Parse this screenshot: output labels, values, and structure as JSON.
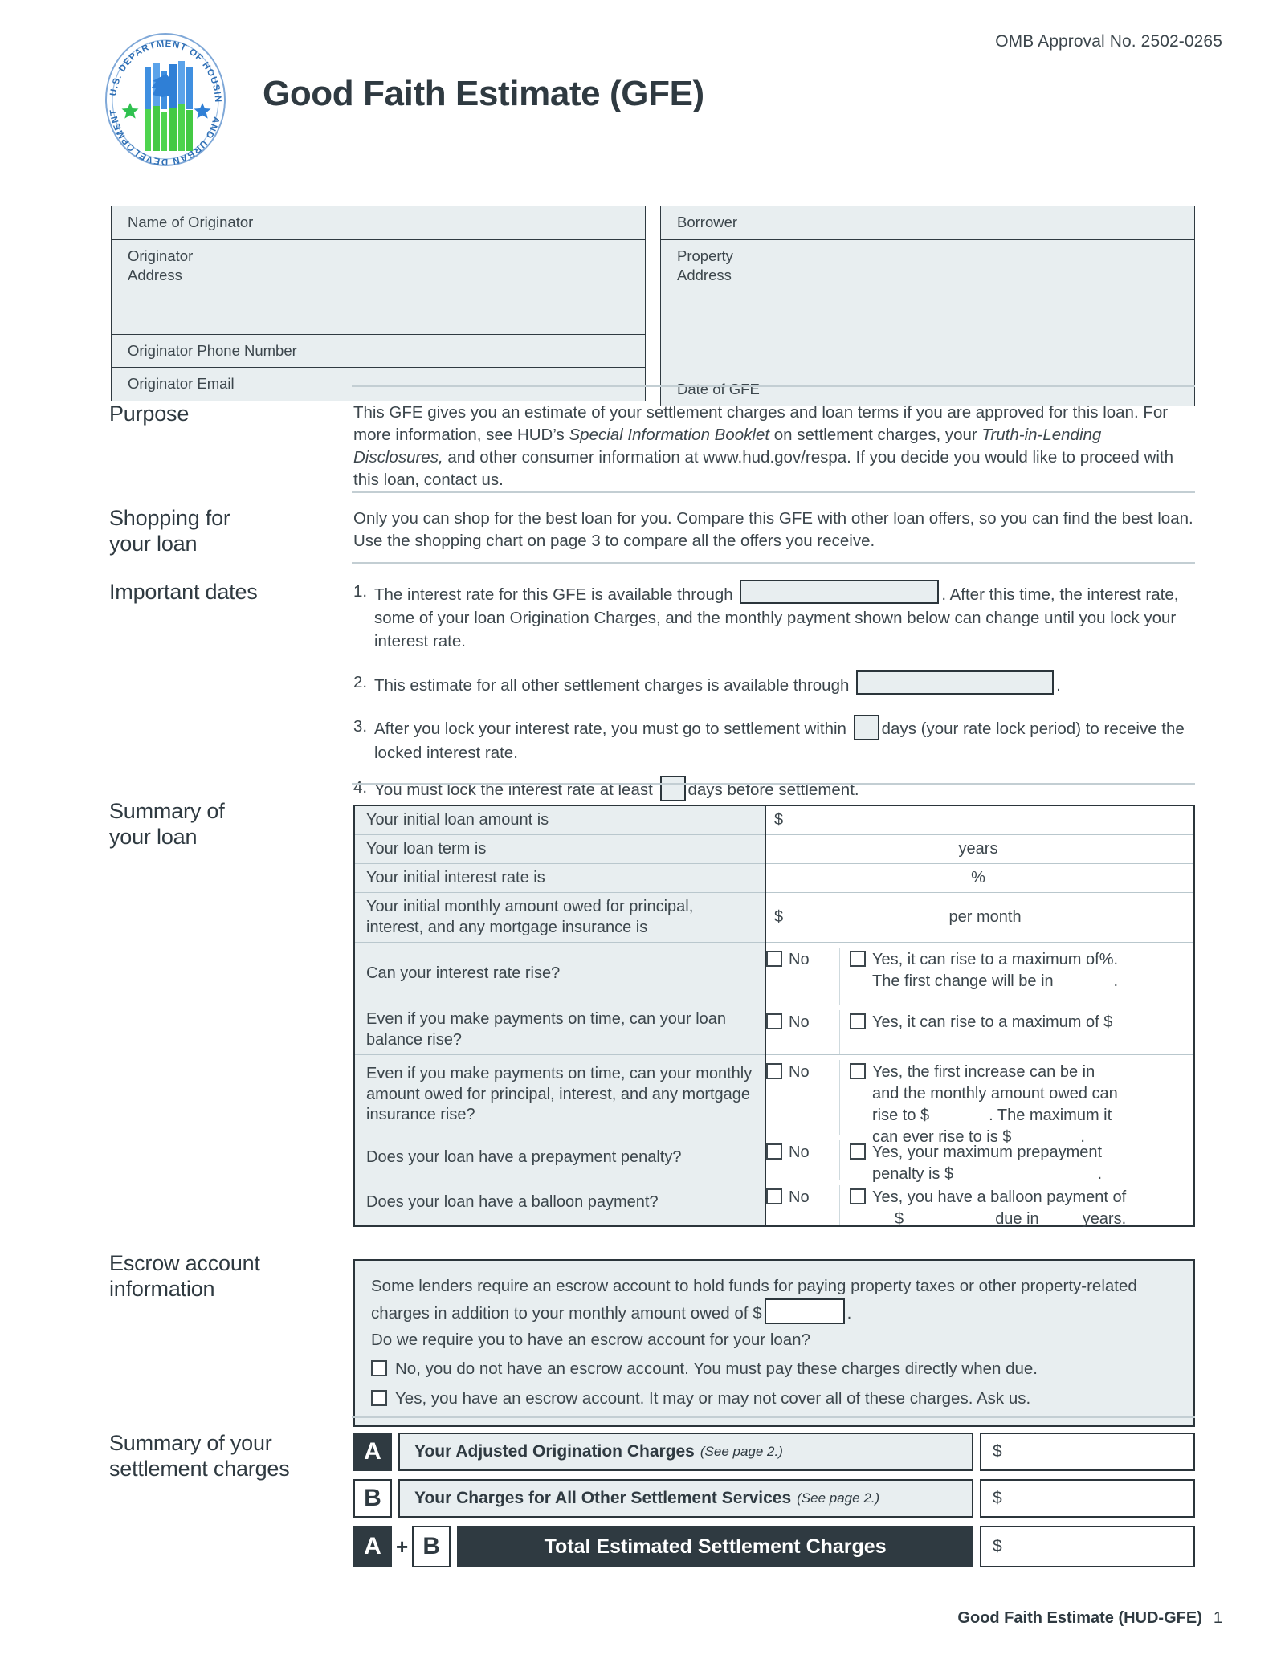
{
  "header": {
    "omb": "OMB Approval No. 2502-0265",
    "title": "Good Faith Estimate (GFE)",
    "seal_alt": "hud-seal"
  },
  "identity": {
    "left": [
      {
        "label": "Name of Originator"
      },
      {
        "label": "Originator\nAddress"
      },
      {
        "label": "Originator Phone Number"
      },
      {
        "label": "Originator Email"
      }
    ],
    "right": [
      {
        "label": "Borrower"
      },
      {
        "label": "Property\nAddress"
      },
      {
        "label": "Date of GFE"
      }
    ],
    "originator_name": "Name of Originator",
    "originator_address": "Originator",
    "originator_address2": "Address",
    "originator_phone": "Originator Phone Number",
    "originator_email": "Originator Email",
    "borrower": "Borrower",
    "property_address": "Property",
    "property_address2": "Address",
    "date_of_gfe": "Date of GFE"
  },
  "purpose": {
    "label": "Purpose",
    "p1": "This GFE gives you an estimate of your settlement charges and loan terms if you are approved for this loan. For more information, see HUD’s ",
    "italic1": "Special Information Booklet",
    "p2": " on settlement charges, your ",
    "italic2": "Truth-in-Lending Disclosures,",
    "p3": " and other consumer information at www.hud.gov/respa. If you decide you would like to proceed with this loan, contact us."
  },
  "shopping": {
    "label": "Shopping for\nyour loan",
    "label_line1": "Shopping for",
    "label_line2": "your loan",
    "body": "Only you can shop for the best loan for you. Compare this GFE with other loan offers, so you can find the best loan. Use the shopping chart on page 3 to compare all the offers you receive."
  },
  "important_dates": {
    "label": "Important dates",
    "item1_num": "1.",
    "item1_a": "The interest rate for this GFE is available through",
    "item1_b": ". After this time, the interest rate, some of your loan Origination Charges, and the monthly payment shown below can change until you lock your interest rate.",
    "item2_num": "2.",
    "item2_a": "This estimate for all other settlement charges is available through",
    "item2_b": ".",
    "item3_num": "3.",
    "item3_a": "After you lock your interest rate, you must go to settlement within",
    "item3_b": "days (your rate lock period) to receive the locked interest rate.",
    "item4_num": "4.",
    "item4_a": "You must lock the interest rate at least",
    "item4_b": "days before settlement."
  },
  "loan_summary": {
    "label_line1": "Summary of",
    "label_line2": "your loan",
    "rows": [
      {
        "question": "Your initial loan amount is",
        "answer_dollar": "$",
        "answer_unit": ""
      },
      {
        "question": "Your loan term is",
        "answer_dollar": "",
        "answer_unit": "years"
      },
      {
        "question": "Your initial interest rate is",
        "answer_dollar": "",
        "answer_unit": "%"
      },
      {
        "question": "Your initial monthly amount owed for principal, interest, and any mortgage insurance is",
        "answer_dollar": "$",
        "answer_unit": "per month"
      }
    ],
    "row1_q": "Your initial loan amount is",
    "row1_a": "$",
    "row2_q": "Your loan term is",
    "row2_a": "years",
    "row3_q": "Your initial interest rate is",
    "row3_a": "%",
    "row4_q": "Your initial monthly amount owed for principal, interest, and any mortgage insurance is",
    "row4_dollar": "$",
    "row4_a": "per month",
    "no_label": "No",
    "q_rate_rise": "Can your interest rate rise?",
    "a_rate_rise_l1": "Yes, it can rise to a maximum of",
    "a_rate_rise_pct": "%.",
    "a_rate_rise_l2": "The first change will be in",
    "a_rate_rise_period": ".",
    "q_balance_rise": "Even if you make payments on time, can your loan balance rise?",
    "a_balance_rise": "Yes, it can rise to a maximum of $",
    "q_monthly_rise": "Even if you make payments on time, can your monthly amount owed for principal, interest, and any mortgage insurance rise?",
    "a_monthly_l1": "Yes, the first increase can be in",
    "a_monthly_l2": "and the monthly amount owed can",
    "a_monthly_l3": "rise to  $",
    "a_monthly_l3b": ". The maximum it",
    "a_monthly_l4": "can ever rise to is $",
    "a_monthly_l4b": ".",
    "q_prepay": "Does your loan have a prepayment penalty?",
    "a_prepay_l1": "Yes, your maximum prepayment",
    "a_prepay_l2": "penalty is $",
    "a_prepay_l2b": ".",
    "q_balloon": "Does your loan have a balloon payment?",
    "a_balloon_l1": "Yes, you have a balloon payment of",
    "a_balloon_l2_dollar": "$",
    "a_balloon_l2_due": "due in",
    "a_balloon_l2_years": "years."
  },
  "escrow": {
    "label_line1": "Escrow account",
    "label_line2": "information",
    "line1a": "Some lenders require an escrow account to hold funds for paying property taxes or other property-related charges in addition to your monthly amount owed of $",
    "line1b": ".",
    "question": "Do we require you to have an escrow account for your loan?",
    "option_no": "No, you do not have an escrow account. You must pay these charges directly when due.",
    "option_yes": "Yes, you have an escrow account. It may or may not cover all of these charges. Ask us."
  },
  "charges_summary": {
    "label_line1": "Summary of your",
    "label_line2": "settlement charges",
    "a_badge": "A",
    "a_label": "Your Adjusted Origination Charges",
    "a_note": "(See page 2.)",
    "a_amount": "$",
    "b_badge": "B",
    "b_label": "Your Charges for All Other Settlement Services",
    "b_note": "(See page 2.)",
    "b_amount": "$",
    "plus": "+",
    "total_label": "Total Estimated Settlement Charges",
    "total_amount": "$"
  },
  "footer": {
    "text": "Good Faith Estimate (HUD-GFE)",
    "page": "1"
  },
  "colors": {
    "shade": "#e8eef0",
    "ink": "#2f3a41",
    "rule": "#c3ced3"
  }
}
